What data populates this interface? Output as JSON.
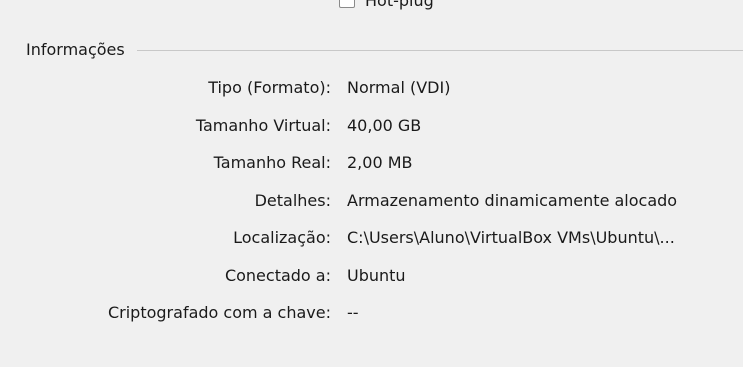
{
  "top_control": {
    "label": "Hot-plug"
  },
  "group": {
    "title": "Informações"
  },
  "rows": [
    {
      "label": "Tipo (Formato):",
      "value": "Normal (VDI)"
    },
    {
      "label": "Tamanho Virtual:",
      "value": "40,00 GB"
    },
    {
      "label": "Tamanho Real:",
      "value": "2,00 MB"
    },
    {
      "label": "Detalhes:",
      "value": "Armazenamento dinamicamente alocado"
    },
    {
      "label": "Localização:",
      "value": "C:\\Users\\Aluno\\VirtualBox VMs\\Ubuntu\\..."
    },
    {
      "label": "Conectado a:",
      "value": "Ubuntu"
    },
    {
      "label": "Criptografado com a chave:",
      "value": "--"
    }
  ]
}
